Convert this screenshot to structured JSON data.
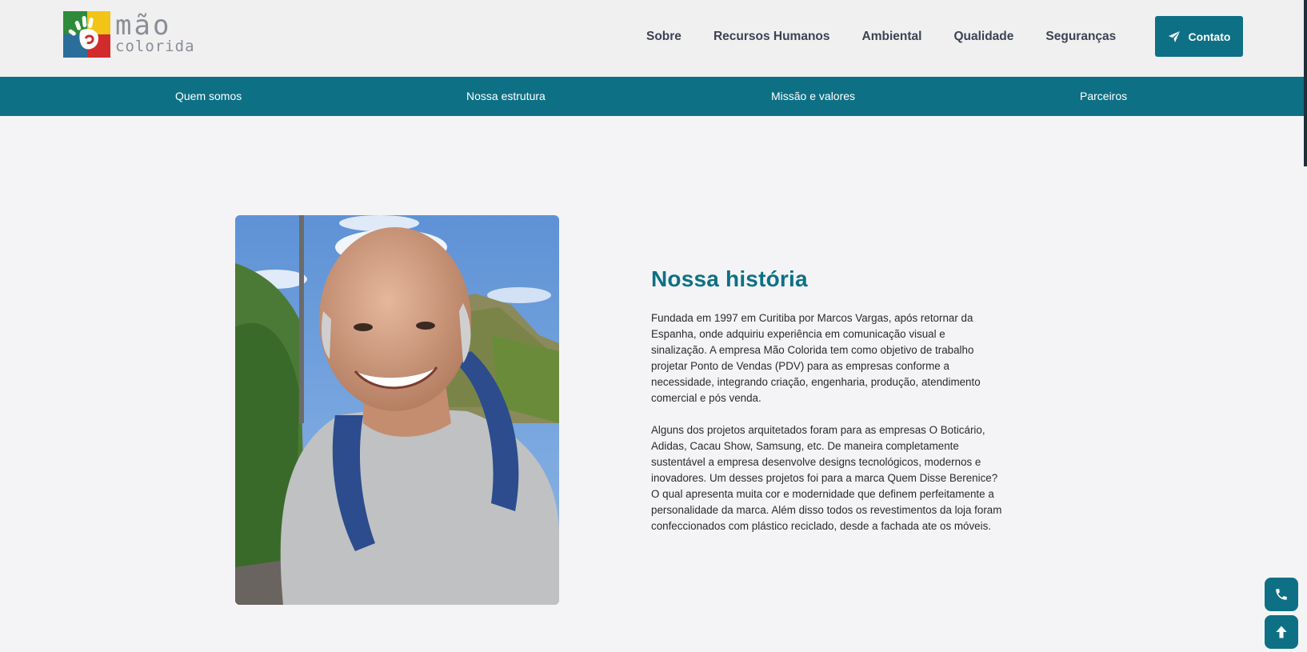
{
  "brand": {
    "logo_line1": "mão",
    "logo_line2": "colorida",
    "colors": {
      "primary": "#0e7085",
      "green": "#2e8b3a",
      "yellow": "#f2c417",
      "blue": "#2a6f9a",
      "red": "#d22b2b"
    }
  },
  "nav": {
    "items": [
      {
        "label": "Sobre"
      },
      {
        "label": "Recursos Humanos"
      },
      {
        "label": "Ambiental"
      },
      {
        "label": "Qualidade"
      },
      {
        "label": "Seguranças"
      }
    ],
    "contact_label": "Contato",
    "contact_icon": "paper-plane-icon"
  },
  "subnav": {
    "items": [
      {
        "label": "Quem somos"
      },
      {
        "label": "Nossa estrutura"
      },
      {
        "label": "Missão e valores"
      },
      {
        "label": "Parceiros"
      }
    ]
  },
  "story": {
    "title": "Nossa história",
    "paragraph1": "Fundada em 1997 em Curitiba por Marcos Vargas, após retornar da Espanha, onde adquiriu experiência em comunicação visual e sinalização. A empresa Mão Colorida tem como objetivo de trabalho projetar Ponto de Vendas (PDV) para as empresas conforme a necessidade, integrando criação, engenharia, produção, atendimento comercial e pós venda.",
    "paragraph2": "Alguns dos projetos arquitetados foram para as empresas O Boticário, Adidas, Cacau Show, Samsung, etc. De maneira completamente sustentável a empresa desenvolve designs tecnológicos, modernos e inovadores. Um desses projetos foi para a marca Quem Disse Berenice? O qual apresenta muita cor e modernidade que definem perfeitamente a personalidade da marca. Além disso todos os revestimentos da loja foram confeccionados com plástico reciclado, desde a fachada ate os móveis."
  },
  "floating": {
    "phone_icon": "phone-icon",
    "top_icon": "arrow-up-icon"
  }
}
